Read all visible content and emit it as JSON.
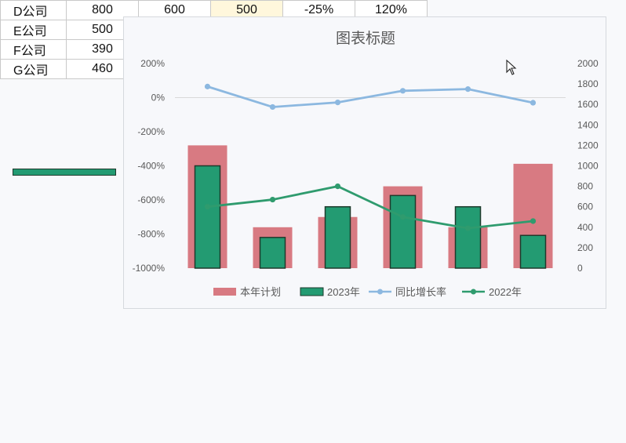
{
  "sheet": {
    "rows": [
      {
        "name": "D公司",
        "v1": "800",
        "v2": "600",
        "v3": "500",
        "v4": "-25%",
        "v5": "120%"
      },
      {
        "name": "E公司",
        "v1": "500"
      },
      {
        "name": "F公司",
        "v1": "390"
      },
      {
        "name": "G公司",
        "v1": "460"
      }
    ]
  },
  "chart_data": {
    "type": "bar",
    "title": "图表标题",
    "categories": [
      "",
      "",
      "",
      "",
      "",
      ""
    ],
    "left_axis": {
      "min": -1000,
      "max": 200,
      "step": 200,
      "unit": "%"
    },
    "right_axis": {
      "min": 0,
      "max": 2000,
      "step": 200
    },
    "series": [
      {
        "name": "本年计划",
        "kind": "bar",
        "axis": "right",
        "color": "#d87a82",
        "values": [
          1200,
          400,
          500,
          800,
          400,
          1020
        ]
      },
      {
        "name": "2023年",
        "kind": "bar",
        "axis": "right",
        "color": "#239b72",
        "values": [
          1000,
          300,
          600,
          710,
          600,
          320
        ]
      },
      {
        "name": "同比增长率",
        "kind": "line",
        "axis": "left",
        "color": "#8cb8e0",
        "values": [
          65,
          -55,
          -28,
          40,
          50,
          -30
        ]
      },
      {
        "name": "2022年",
        "kind": "line",
        "axis": "right",
        "color": "#2f9b6e",
        "values": [
          600,
          670,
          800,
          500,
          390,
          460
        ]
      }
    ],
    "grid": true,
    "legend": "bottom"
  }
}
